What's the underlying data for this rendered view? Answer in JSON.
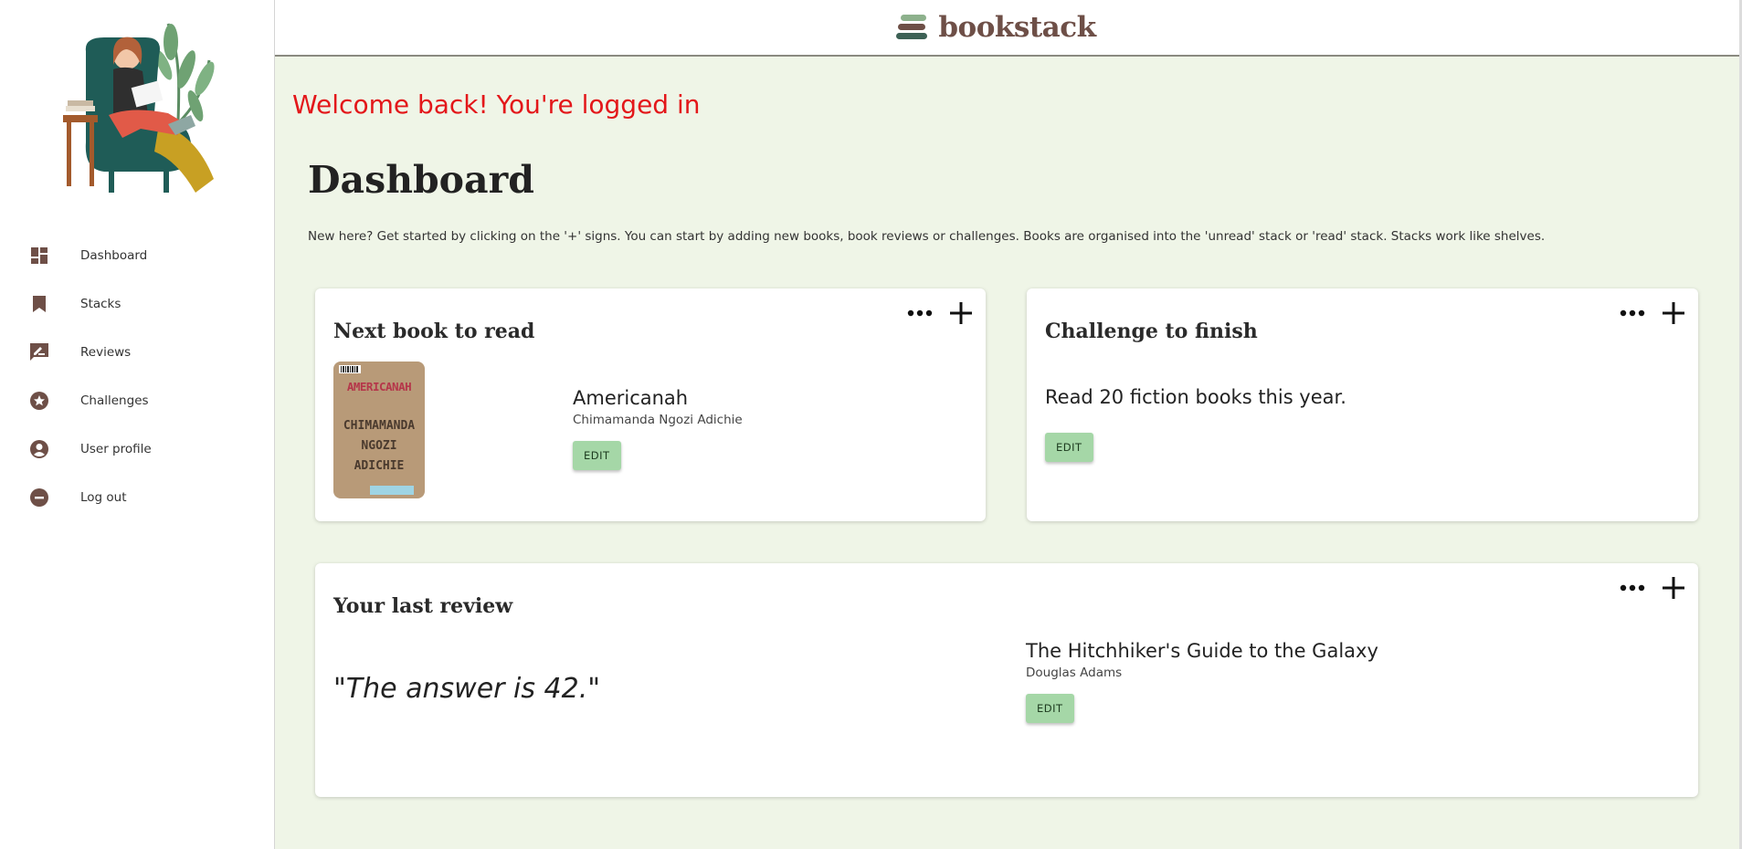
{
  "app": {
    "name": "bookstack"
  },
  "colors": {
    "accent_button": "#a5d7a7",
    "welcome": "#e3171a",
    "brand": "#6e4f47",
    "background": "#eff5e7"
  },
  "sidebar": {
    "items": [
      {
        "label": "Dashboard",
        "icon": "dashboard-icon"
      },
      {
        "label": "Stacks",
        "icon": "bookmark-icon"
      },
      {
        "label": "Reviews",
        "icon": "rate-review-icon"
      },
      {
        "label": "Challenges",
        "icon": "stars-icon"
      },
      {
        "label": "User profile",
        "icon": "account-circle-icon"
      },
      {
        "label": "Log out",
        "icon": "do-not-disturb-icon"
      }
    ]
  },
  "main": {
    "welcome": "Welcome back! You're logged in",
    "title": "Dashboard",
    "intro": "New here? Get started by clicking on the '+' signs. You can start by adding new books, book reviews or challenges. Books are organised into the 'unread' stack or 'read' stack. Stacks work like shelves."
  },
  "next_book": {
    "heading": "Next book to read",
    "title": "Americanah",
    "author": "Chimamanda Ngozi Adichie",
    "edit_label": "EDIT",
    "cover": {
      "title": "AMERICANAH",
      "author_lines": [
        "CHIMAMANDA",
        "NGOZI",
        "ADICHIE"
      ]
    }
  },
  "challenge": {
    "heading": "Challenge to finish",
    "text": "Read 20 fiction books this year.",
    "edit_label": "EDIT"
  },
  "review": {
    "heading": "Your last review",
    "quote": "\"The answer is 42.\"",
    "book_title": "The Hitchhiker's Guide to the Galaxy",
    "author": "Douglas Adams",
    "edit_label": "EDIT"
  }
}
